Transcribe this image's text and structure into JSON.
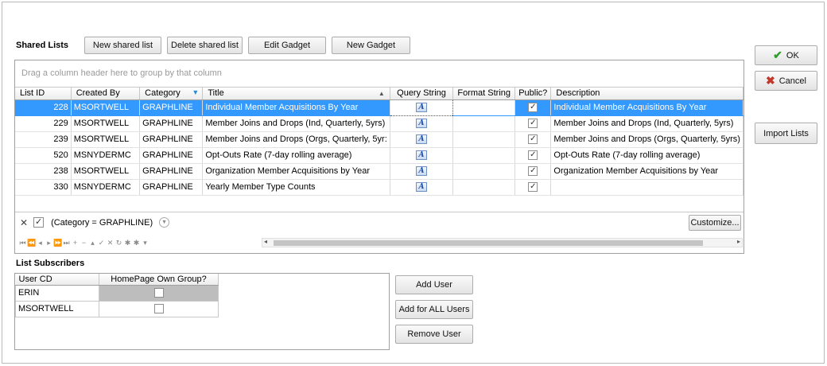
{
  "shared_lists": {
    "title": "Shared Lists",
    "buttons": {
      "new_shared_list": "New shared list",
      "delete_shared_list": "Delete shared list",
      "edit_gadget": "Edit Gadget",
      "new_gadget": "New Gadget"
    },
    "group_panel_hint": "Drag a column header here to group by that column",
    "columns": [
      "List ID",
      "Created By",
      "Category",
      "Title",
      "Query String",
      "Format String",
      "Public?",
      "Description"
    ],
    "rows": [
      {
        "id": "228",
        "created_by": "MSORTWELL",
        "category": "GRAPHLINE",
        "title": "Individual Member Acquisitions By Year",
        "public": "✓",
        "description": "Individual Member Acquisitions By Year",
        "selected": true
      },
      {
        "id": "229",
        "created_by": "MSORTWELL",
        "category": "GRAPHLINE",
        "title": "Member Joins and Drops (Ind, Quarterly, 5yrs)",
        "public": "✓",
        "description": "Member Joins and Drops (Ind, Quarterly, 5yrs)"
      },
      {
        "id": "239",
        "created_by": "MSORTWELL",
        "category": "GRAPHLINE",
        "title": "Member Joins and Drops (Orgs, Quarterly, 5yr:",
        "public": "✓",
        "description": "Member Joins and Drops (Orgs, Quarterly, 5yrs)"
      },
      {
        "id": "520",
        "created_by": "MSNYDERMC",
        "category": "GRAPHLINE",
        "title": "Opt-Outs Rate (7-day rolling average)",
        "public": "✓",
        "description": "Opt-Outs Rate (7-day rolling average)"
      },
      {
        "id": "238",
        "created_by": "MSORTWELL",
        "category": "GRAPHLINE",
        "title": "Organization Member Acquisitions by Year",
        "public": "✓",
        "description": "Organization Member Acquisitions by Year"
      },
      {
        "id": "330",
        "created_by": "MSNYDERMC",
        "category": "GRAPHLINE",
        "title": "Yearly Member Type Counts",
        "public": "✓",
        "description": ""
      }
    ],
    "query_icon_glyph": "A",
    "filter": {
      "expression": "(Category = GRAPHLINE)",
      "close_glyph": "✕",
      "enabled_glyph": "✓",
      "customize_label": "Customize..."
    },
    "navigator_glyphs": [
      "⏮",
      "⏪",
      "◂",
      "▸",
      "⏩",
      "⏭",
      "+",
      "−",
      "▴",
      "✓",
      "✕",
      "↻",
      "✱",
      "✱",
      "▾"
    ]
  },
  "side_buttons": {
    "ok": "OK",
    "cancel": "Cancel",
    "import_lists": "Import Lists",
    "ok_glyph": "✔",
    "cancel_glyph": "✖"
  },
  "subscribers": {
    "title": "List Subscribers",
    "columns": [
      "User CD",
      "HomePage Own Group?"
    ],
    "rows": [
      {
        "user": "ERIN",
        "own_group": ""
      },
      {
        "user": "MSORTWELL",
        "own_group": ""
      }
    ],
    "buttons": {
      "add_user": "Add User",
      "add_all_users": "Add for ALL Users",
      "remove_user": "Remove User"
    }
  },
  "colors": {
    "selection": "#3399ff",
    "ok_green": "#2f9e2f",
    "cancel_red": "#c0392b"
  }
}
